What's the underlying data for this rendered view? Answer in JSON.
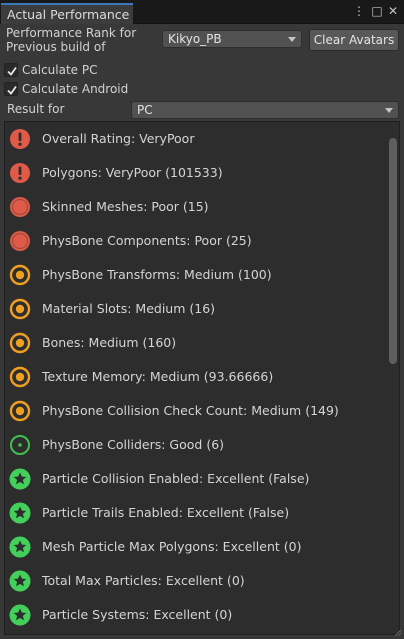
{
  "window": {
    "tab_title": "Actual Performance",
    "menu_glyph": "⋮",
    "maximize_glyph": "□",
    "close_glyph": "✕"
  },
  "header": {
    "rank_label_line1": "Performance Rank for",
    "rank_label_line2": "Previous build of",
    "avatar_dropdown": "Kikyo_PB",
    "clear_button": "Clear Avatars",
    "calculate_pc": "Calculate PC",
    "calculate_android": "Calculate Android",
    "calculate_pc_checked": true,
    "calculate_android_checked": true,
    "result_label": "Result for",
    "result_dropdown": "PC"
  },
  "colors": {
    "verypoor": "#e05a48",
    "poor": "#e05a48",
    "medium": "#f0a020",
    "good": "#3fc04f",
    "excellent": "#42d05a"
  },
  "results": [
    {
      "text": "Overall Rating: VeryPoor",
      "rating": "verypoor",
      "icon": "exclamation-icon"
    },
    {
      "text": "Polygons: VeryPoor (101533)",
      "rating": "verypoor",
      "icon": "exclamation-icon"
    },
    {
      "text": "Skinned Meshes: Poor (15)",
      "rating": "poor",
      "icon": "poor-dot-icon"
    },
    {
      "text": "PhysBone Components: Poor (25)",
      "rating": "poor",
      "icon": "poor-dot-icon"
    },
    {
      "text": "PhysBone Transforms: Medium (100)",
      "rating": "medium",
      "icon": "medium-ring-icon"
    },
    {
      "text": "Material Slots: Medium (16)",
      "rating": "medium",
      "icon": "medium-ring-icon"
    },
    {
      "text": "Bones: Medium (160)",
      "rating": "medium",
      "icon": "medium-ring-icon"
    },
    {
      "text": "Texture Memory: Medium (93.66666)",
      "rating": "medium",
      "icon": "medium-ring-icon"
    },
    {
      "text": "PhysBone Collision Check Count: Medium (149)",
      "rating": "medium",
      "icon": "medium-ring-icon"
    },
    {
      "text": "PhysBone Colliders: Good (6)",
      "rating": "good",
      "icon": "good-ring-icon"
    },
    {
      "text": "Particle Collision Enabled: Excellent (False)",
      "rating": "excellent",
      "icon": "star-icon"
    },
    {
      "text": "Particle Trails Enabled: Excellent (False)",
      "rating": "excellent",
      "icon": "star-icon"
    },
    {
      "text": "Mesh Particle Max Polygons: Excellent (0)",
      "rating": "excellent",
      "icon": "star-icon"
    },
    {
      "text": "Total Max Particles: Excellent (0)",
      "rating": "excellent",
      "icon": "star-icon"
    },
    {
      "text": "Particle Systems: Excellent (0)",
      "rating": "excellent",
      "icon": "star-icon"
    }
  ]
}
